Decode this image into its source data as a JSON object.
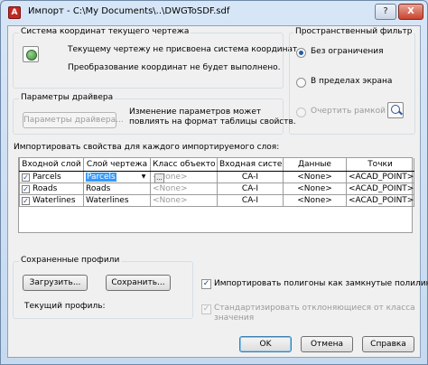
{
  "window": {
    "title": "Импорт - C:\\My Documents\\..\\DWGToSDF.sdf",
    "help_label": "?",
    "close_label": "X",
    "app_icon_letter": "A",
    "app_icon": "autocad-app-icon"
  },
  "coord_system": {
    "group_label": "Система координат текущего чертежа",
    "line1": "Текущему чертежу не присвоена система координат.",
    "line2": "Преобразование координат не будет выполнено.",
    "icon": "globe-icon"
  },
  "spatial_filter": {
    "group_label": "Пространственный фильтр",
    "options": [
      {
        "label": "Без ограничения",
        "checked": true,
        "enabled": true
      },
      {
        "label": "В пределах экрана",
        "checked": false,
        "enabled": true
      },
      {
        "label": "Очертить рамкой",
        "checked": false,
        "enabled": false
      }
    ],
    "icon": "zoom-window-icon"
  },
  "driver": {
    "group_label": "Параметры драйвера",
    "button_label": "Параметры драйвера...",
    "note_line1": "Изменение параметров может",
    "note_line2": "повлиять на формат таблицы свойств."
  },
  "layers": {
    "heading": "Импортировать свойства для каждого импортируемого слоя:",
    "columns": [
      "Входной слой",
      "Слой чертежа",
      "Класс объекто",
      "Входная систе",
      "Данные",
      "Точки"
    ],
    "rows": [
      {
        "checked": true,
        "input_layer": "Parcels",
        "drawing_layer": "Parcels",
        "object_class": "<None>",
        "input_system": "CA-I",
        "data": "<None>",
        "points": "<ACAD_POINT>"
      },
      {
        "checked": true,
        "input_layer": "Roads",
        "drawing_layer": "Roads",
        "object_class": "<None>",
        "input_system": "CA-I",
        "data": "<None>",
        "points": "<ACAD_POINT>"
      },
      {
        "checked": true,
        "input_layer": "Waterlines",
        "drawing_layer": "Waterlines",
        "object_class": "<None>",
        "input_system": "CA-I",
        "data": "<None>",
        "points": "<ACAD_POINT>"
      }
    ],
    "dropdown_arrow": "▼",
    "ellipsis": "..."
  },
  "profiles": {
    "group_label": "Сохраненные профили",
    "load_label": "Загрузить...",
    "save_label": "Сохранить...",
    "current_label": "Текущий профиль:"
  },
  "options": {
    "closed_polygons": {
      "label": "Импортировать полигоны как замкнутые полилинии",
      "checked": true
    },
    "standardize_line1": "Стандартизировать отклоняющиеся от класса",
    "standardize_line2": "значения",
    "standardize_checked": true
  },
  "buttons": {
    "ok": "OK",
    "cancel": "Отмена",
    "help": "Справка"
  }
}
